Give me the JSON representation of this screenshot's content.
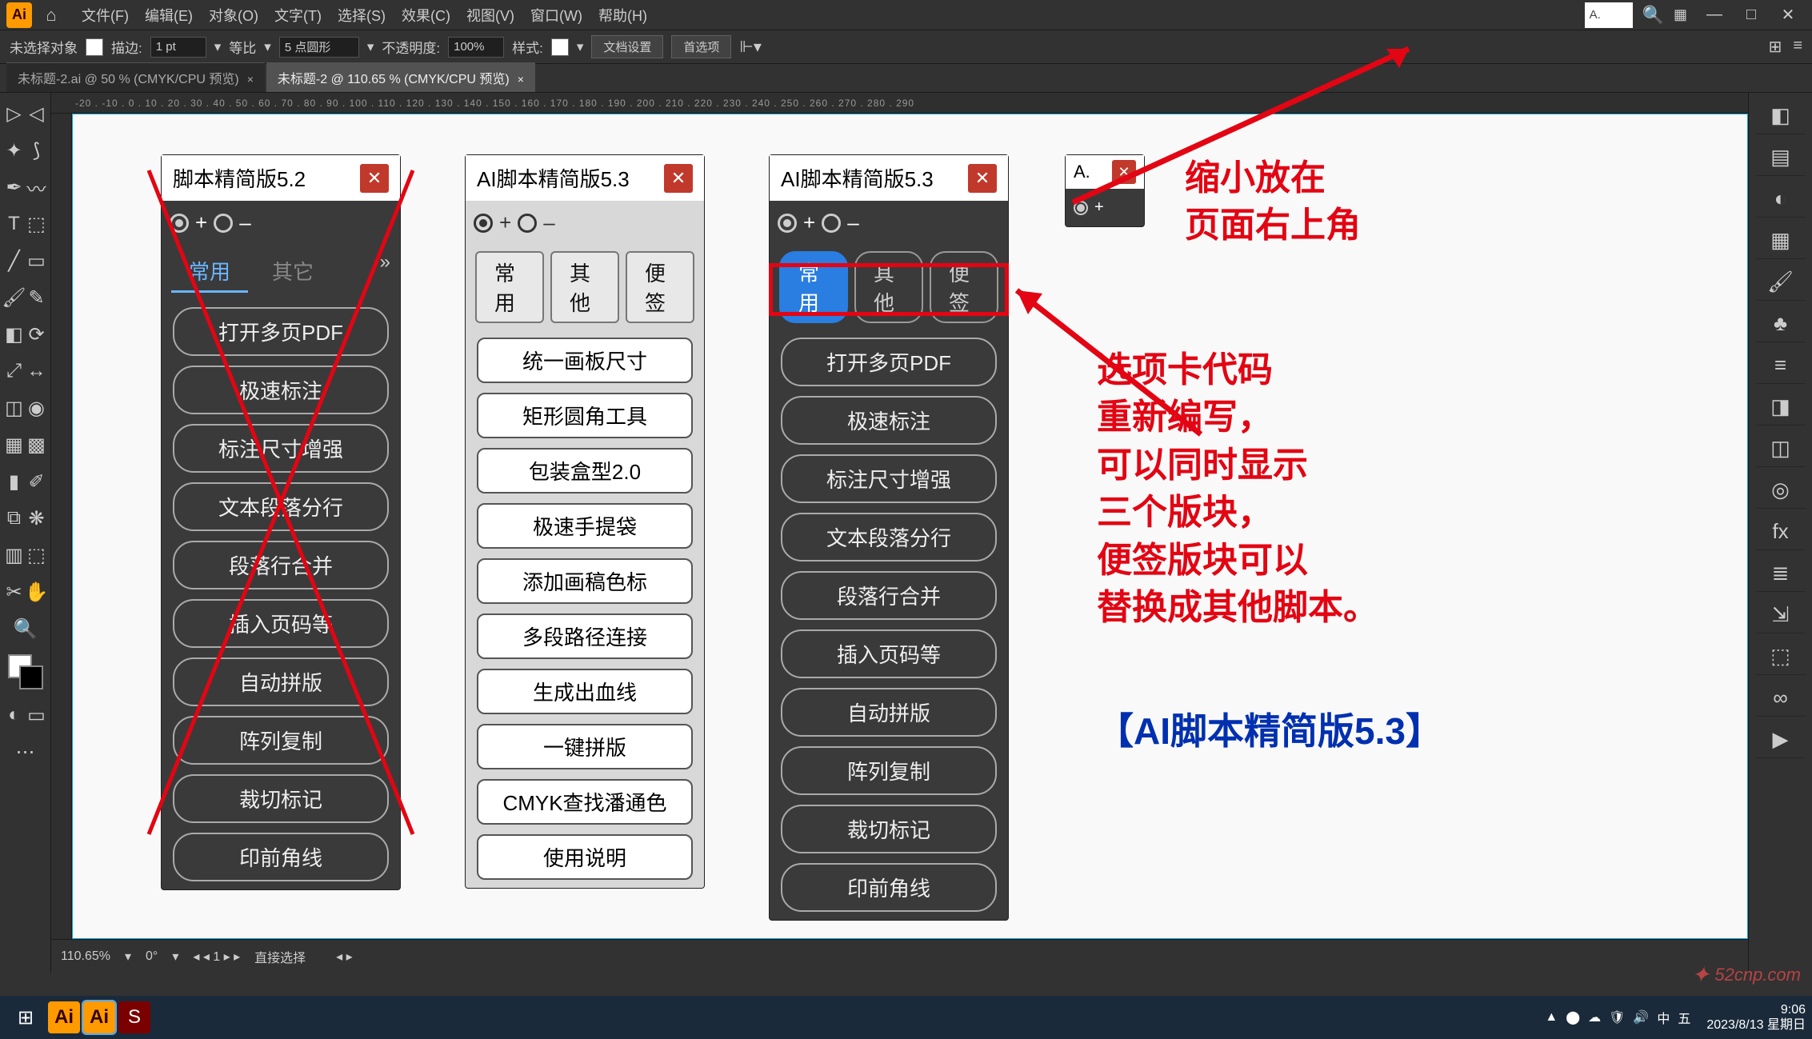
{
  "menubar": {
    "items": [
      "文件(F)",
      "编辑(E)",
      "对象(O)",
      "文字(T)",
      "选择(S)",
      "效果(C)",
      "视图(V)",
      "窗口(W)",
      "帮助(H)"
    ],
    "mini_panel": "A."
  },
  "controlbar": {
    "no_selection": "未选择对象",
    "stroke_label": "描边:",
    "stroke_value": "1 pt",
    "uniform": "等比",
    "corner_value": "5 点圆形",
    "opacity_label": "不透明度:",
    "opacity_value": "100%",
    "style_label": "样式:",
    "doc_setup": "文档设置",
    "preferences": "首选项"
  },
  "tabs": [
    {
      "label": "未标题-2.ai @ 50 % (CMYK/CPU 预览)",
      "active": false
    },
    {
      "label": "未标题-2 @ 110.65 % (CMYK/CPU 预览)",
      "active": true
    }
  ],
  "ruler": "-20 . -10 . 0 . 10 . 20 . 30 . 40 . 50 . 60 . 70 . 80 . 90 . 100 . 110 . 120 . 130 . 140 . 150 . 160 . 170 . 180 . 190 . 200 . 210 . 220 . 230 . 240 . 250 . 260 . 270 . 280 . 290",
  "panels": {
    "v52": {
      "title": "脚本精简版5.2",
      "tabs": [
        "常用",
        "其它"
      ],
      "buttons": [
        "打开多页PDF",
        "极速标注",
        "标注尺寸增强",
        "文本段落分行",
        "段落行合并",
        "插入页码等",
        "自动拼版",
        "阵列复制",
        "裁切标记",
        "印前角线"
      ]
    },
    "v53_light": {
      "title": "AI脚本精简版5.3",
      "tabs": [
        "常用",
        "其他",
        "便签"
      ],
      "buttons": [
        "统一画板尺寸",
        "矩形圆角工具",
        "包装盒型2.0",
        "极速手提袋",
        "添加画稿色标",
        "多段路径连接",
        "生成出血线",
        "一键拼版",
        "CMYK查找潘通色",
        "使用说明"
      ]
    },
    "v53_dark": {
      "title": "AI脚本精简版5.3",
      "tabs": [
        "常用",
        "其他",
        "便签"
      ],
      "buttons": [
        "打开多页PDF",
        "极速标注",
        "标注尺寸增强",
        "文本段落分行",
        "段落行合并",
        "插入页码等",
        "自动拼版",
        "阵列复制",
        "裁切标记",
        "印前角线"
      ]
    },
    "mini": {
      "title": "A."
    }
  },
  "annotations": {
    "a1_l1": "缩小放在",
    "a1_l2": "页面右上角",
    "a2_l1": "选项卡代码",
    "a2_l2": "重新编写，",
    "a2_l3": "可以同时显示",
    "a2_l4": "三个版块，",
    "a2_l5": "便签版块可以",
    "a2_l6": "替换成其他脚本。",
    "a3": "【AI脚本精简版5.3】"
  },
  "status": {
    "zoom": "110.65%",
    "nav": "1",
    "tool": "直接选择"
  },
  "taskbar": {
    "time": "9:06",
    "date": "2023/8/13 星期日"
  },
  "watermark": "52cnp.com"
}
